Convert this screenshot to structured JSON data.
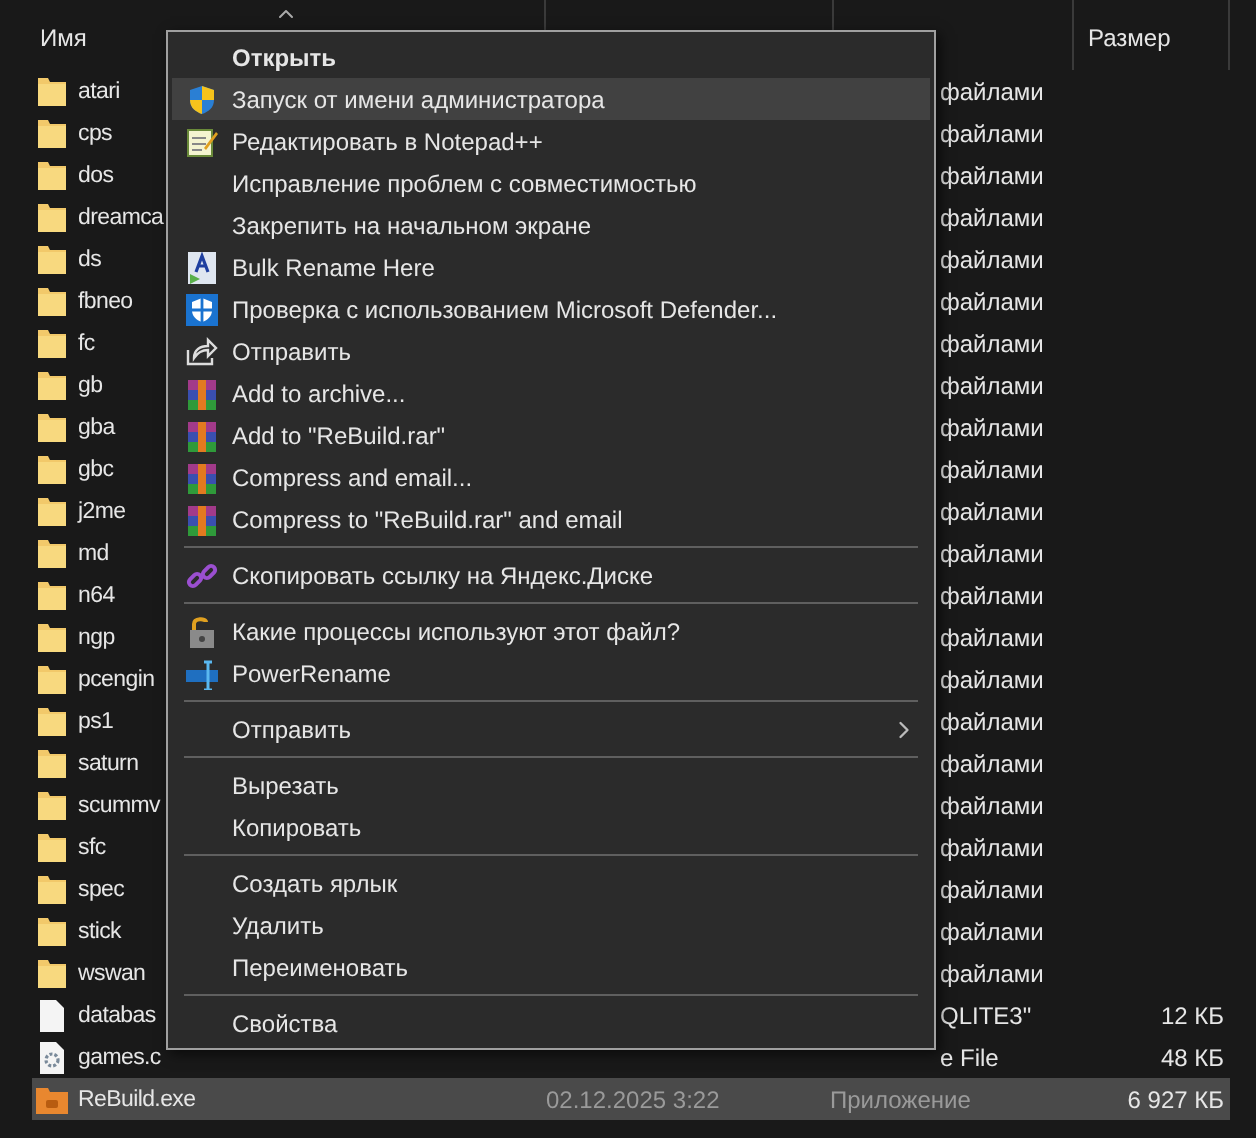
{
  "header": {
    "columns": [
      {
        "label": "Имя"
      },
      {
        "label": "Размер"
      }
    ]
  },
  "files": [
    {
      "kind": "folder",
      "name": "atari",
      "type": "файлами",
      "selected": false
    },
    {
      "kind": "folder",
      "name": "cps",
      "type": "файлами",
      "selected": false
    },
    {
      "kind": "folder",
      "name": "dos",
      "type": "файлами",
      "selected": false
    },
    {
      "kind": "folder",
      "name": "dreamca",
      "type": "файлами",
      "selected": false
    },
    {
      "kind": "folder",
      "name": "ds",
      "type": "файлами",
      "selected": false
    },
    {
      "kind": "folder",
      "name": "fbneo",
      "type": "файлами",
      "selected": false
    },
    {
      "kind": "folder",
      "name": "fc",
      "type": "файлами",
      "selected": false
    },
    {
      "kind": "folder",
      "name": "gb",
      "type": "файлами",
      "selected": false
    },
    {
      "kind": "folder",
      "name": "gba",
      "type": "файлами",
      "selected": false
    },
    {
      "kind": "folder",
      "name": "gbc",
      "type": "файлами",
      "selected": false
    },
    {
      "kind": "folder",
      "name": "j2me",
      "type": "файлами",
      "selected": false
    },
    {
      "kind": "folder",
      "name": "md",
      "type": "файлами",
      "selected": false
    },
    {
      "kind": "folder",
      "name": "n64",
      "type": "файлами",
      "selected": false
    },
    {
      "kind": "folder",
      "name": "ngp",
      "type": "файлами",
      "selected": false
    },
    {
      "kind": "folder",
      "name": "pcengin",
      "type": "файлами",
      "selected": false
    },
    {
      "kind": "folder",
      "name": "ps1",
      "type": "файлами",
      "selected": false
    },
    {
      "kind": "folder",
      "name": "saturn",
      "type": "файлами",
      "selected": false
    },
    {
      "kind": "folder",
      "name": "scummv",
      "type": "файлами",
      "selected": false
    },
    {
      "kind": "folder",
      "name": "sfc",
      "type": "файлами",
      "selected": false
    },
    {
      "kind": "folder",
      "name": "spec",
      "type": "файлами",
      "selected": false
    },
    {
      "kind": "folder",
      "name": "stick",
      "type": "файлами",
      "selected": false
    },
    {
      "kind": "folder",
      "name": "wswan",
      "type": "файлами",
      "selected": false
    },
    {
      "kind": "file",
      "name": "databas",
      "type": "QLITE3\"",
      "size": "12 КБ",
      "selected": false
    },
    {
      "kind": "config",
      "name": "games.c",
      "type": "e File",
      "size": "48 КБ",
      "selected": false
    },
    {
      "kind": "app",
      "name": "ReBuild.exe",
      "date": "02.12.2025 3:22",
      "type": "Приложение",
      "size": "6 927 КБ",
      "selected": true
    }
  ],
  "context_menu": {
    "groups": [
      [
        {
          "label": "Открыть",
          "bold": true,
          "selected": false,
          "submenu": false
        },
        {
          "label": "Запуск от имени администратора",
          "bold": false,
          "selected": true,
          "submenu": false
        },
        {
          "label": "Редактировать в Notepad++",
          "bold": false,
          "selected": false,
          "submenu": false
        },
        {
          "label": "Исправление проблем с совместимостью",
          "bold": false,
          "selected": false,
          "submenu": false
        },
        {
          "label": "Закрепить на начальном экране",
          "bold": false,
          "selected": false,
          "submenu": false
        },
        {
          "label": "Bulk Rename Here",
          "bold": false,
          "selected": false,
          "submenu": false
        },
        {
          "label": "Проверка с использованием Microsoft Defender...",
          "bold": false,
          "selected": false,
          "submenu": false
        },
        {
          "label": "Отправить",
          "bold": false,
          "selected": false,
          "submenu": false
        },
        {
          "label": "Add to archive...",
          "bold": false,
          "selected": false,
          "submenu": false
        },
        {
          "label": "Add to \"ReBuild.rar\"",
          "bold": false,
          "selected": false,
          "submenu": false
        },
        {
          "label": "Compress and email...",
          "bold": false,
          "selected": false,
          "submenu": false
        },
        {
          "label": "Compress to \"ReBuild.rar\" and email",
          "bold": false,
          "selected": false,
          "submenu": false
        }
      ],
      [
        {
          "label": "Скопировать ссылку на Яндекс.Диске",
          "bold": false,
          "selected": false,
          "submenu": false
        }
      ],
      [
        {
          "label": "Какие процессы используют этот файл?",
          "bold": false,
          "selected": false,
          "submenu": false
        },
        {
          "label": "PowerRename",
          "bold": false,
          "selected": false,
          "submenu": false
        }
      ],
      [
        {
          "label": "Отправить",
          "bold": false,
          "selected": false,
          "submenu": true
        }
      ],
      [
        {
          "label": "Вырезать",
          "bold": false,
          "selected": false,
          "submenu": false
        },
        {
          "label": "Копировать",
          "bold": false,
          "selected": false,
          "submenu": false
        }
      ],
      [
        {
          "label": "Создать ярлык",
          "bold": false,
          "selected": false,
          "submenu": false
        },
        {
          "label": "Удалить",
          "bold": false,
          "selected": false,
          "submenu": false
        },
        {
          "label": "Переименовать",
          "bold": false,
          "selected": false,
          "submenu": false
        }
      ],
      [
        {
          "label": "Свойства",
          "bold": false,
          "selected": false,
          "submenu": false
        }
      ]
    ]
  }
}
